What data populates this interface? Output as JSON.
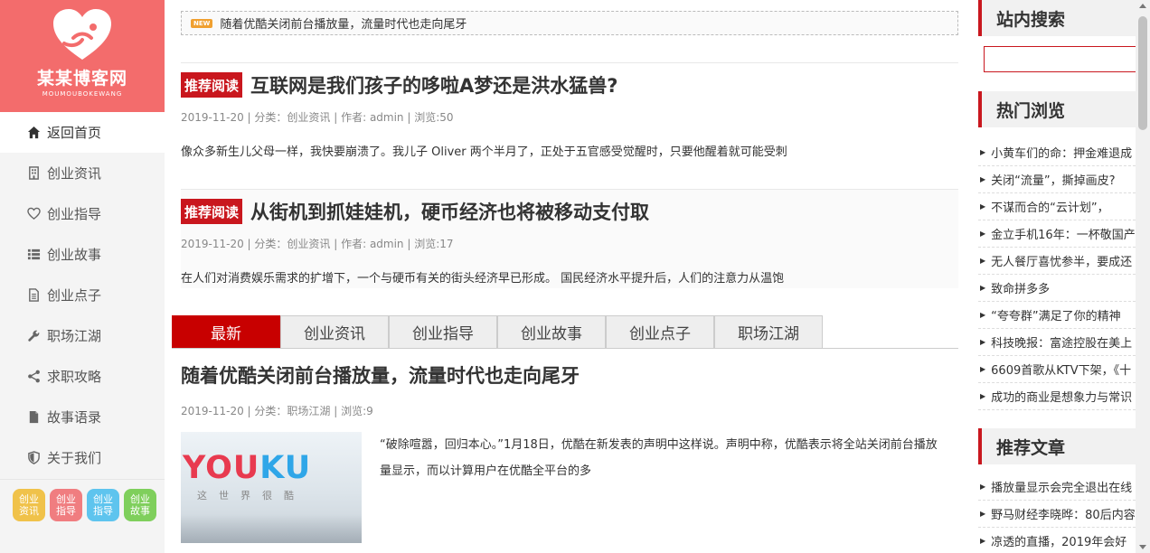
{
  "sidebar": {
    "logo": {
      "brand": "某某博客网",
      "sub": "MOUMOUBOKEWANG"
    },
    "items": [
      {
        "label": "返回首页",
        "icon": "home-icon"
      },
      {
        "label": "创业资讯",
        "icon": "building-icon"
      },
      {
        "label": "创业指导",
        "icon": "heart-icon"
      },
      {
        "label": "创业故事",
        "icon": "list-icon"
      },
      {
        "label": "创业点子",
        "icon": "document-icon"
      },
      {
        "label": "职场江湖",
        "icon": "wrench-icon"
      },
      {
        "label": "求职攻略",
        "icon": "share-icon"
      },
      {
        "label": "故事语录",
        "icon": "file-icon"
      },
      {
        "label": "关于我们",
        "icon": "shield-icon"
      }
    ],
    "tags": [
      {
        "label": "创业资讯",
        "color": "#f0c24a"
      },
      {
        "label": "创业指导",
        "color": "#f07d80"
      },
      {
        "label": "创业指导",
        "color": "#5ec4ee"
      },
      {
        "label": "创业故事",
        "color": "#7fcf5c"
      }
    ]
  },
  "ticker": {
    "badge": "NEW",
    "text": "随着优酷关闭前台播放量，流量时代也走向尾牙"
  },
  "recommended": [
    {
      "badge": "推荐阅读",
      "title": "互联网是我们孩子的哆啦A梦还是洪水猛兽?",
      "meta": "2019-11-20 | 分类：创业资讯 | 作者: admin | 浏览:50",
      "excerpt": "像众多新生儿父母一样，我快要崩溃了。我儿子 Oliver 两个半月了，正处于五官感受觉醒时，只要他醒着就可能受刺"
    },
    {
      "badge": "推荐阅读",
      "title": "从街机到抓娃娃机，硬币经济也将被移动支付取",
      "meta": "2019-11-20 | 分类：创业资讯 | 作者: admin | 浏览:17",
      "excerpt": "在人们对消费娱乐需求的扩增下，一个与硬币有关的街头经济早已形成。 国民经济水平提升后，人们的注意力从温饱"
    }
  ],
  "tabs": [
    "最新",
    "创业资讯",
    "创业指导",
    "创业故事",
    "创业点子",
    "职场江湖"
  ],
  "latest": {
    "title": "随着优酷关闭前台播放量，流量时代也走向尾牙",
    "meta": "2019-11-20 | 分类：职场江湖 | 浏览:9",
    "thumb_red": "YOU",
    "thumb_blue": "KU",
    "thumb_caption": "这世界很酷",
    "excerpt": "“破除喧嚣，回归本心。”1月18日，优酷在新发表的声明中这样说。声明中称，优酷表示将全站关闭前台播放量显示，而以计算用户在优酷全平台的多"
  },
  "right": {
    "search_title": "站内搜索",
    "hot_title": "热门浏览",
    "hot": [
      "小黄车们的命：押金难退成",
      "关闭“流量”，撕掉画皮?",
      "不谋而合的“云计划”，",
      "金立手机16年：一杯敬国产",
      "无人餐厅喜忧参半，要成还",
      "致命拼多多",
      "“夸夸群”满足了你的精神",
      "科技晚报：富途控股在美上",
      "6609首歌从KTV下架，《十",
      "成功的商业是想象力与常识"
    ],
    "rec_title": "推荐文章",
    "rec": [
      "播放量显示会完全退出在线",
      "野马财经李晓晔：80后内容",
      "凉透的直播，2019年会好"
    ]
  }
}
